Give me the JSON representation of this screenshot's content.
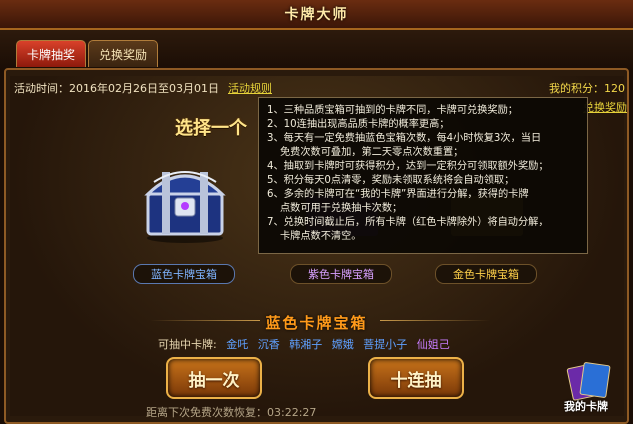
{
  "window": {
    "title": "卡牌大师"
  },
  "tabs": [
    {
      "label": "卡牌抽奖"
    },
    {
      "label": "兑换奖励"
    }
  ],
  "event": {
    "time_text": "活动时间：2016年02月26日至03月01日",
    "rules_link": "活动规则"
  },
  "score": {
    "text": "我的积分：120"
  },
  "reward_link": "兑换奖励",
  "select_title": "选择一个",
  "chests": [
    {
      "name": "蓝色卡牌宝箱",
      "color": "#1e3a8a"
    },
    {
      "name": "紫色卡牌宝箱",
      "color": "#6b2aa8"
    },
    {
      "name": "金色卡牌宝箱",
      "color": "#b8860b"
    }
  ],
  "selected": {
    "name": "蓝色卡牌宝箱"
  },
  "cards": {
    "label": "可抽中卡牌:",
    "names": [
      {
        "name": "金吒",
        "color": "#5fa0ff"
      },
      {
        "name": "沉香",
        "color": "#5fa0ff"
      },
      {
        "name": "韩湘子",
        "color": "#5fa0ff"
      },
      {
        "name": "嫦娥",
        "color": "#5fa0ff"
      },
      {
        "name": "菩提小子",
        "color": "#5fa0ff"
      },
      {
        "name": "仙姐己",
        "color": "#c77dff"
      }
    ]
  },
  "buttons": {
    "draw_once": "抽一次",
    "draw_ten": "十连抽"
  },
  "timer": {
    "text": "距离下次免费次数恢复：03:22:27"
  },
  "my_cards": {
    "label": "我的卡牌"
  },
  "tooltip": {
    "lines": [
      "1、三种品质宝箱可抽到的卡牌不同，卡牌可兑换奖励；",
      "2、10连抽出现高品质卡牌的概率更高；",
      "3、每天有一定免费抽蓝色宝箱次数，每4小时恢复3次，当日",
      "    免费次数可叠加，第二天零点次数重置；",
      "4、抽取到卡牌时可获得积分，达到一定积分可领取额外奖励；",
      "5、积分每天0点清零，奖励未领取系统将会自动领取；",
      "6、多余的卡牌可在“我的卡牌”界面进行分解，获得的卡牌",
      "    点数可用于兑换抽卡次数；",
      "7、兑换时间截止后，所有卡牌（红色卡牌除外）将自动分解，",
      "    卡牌点数不清空。"
    ]
  }
}
